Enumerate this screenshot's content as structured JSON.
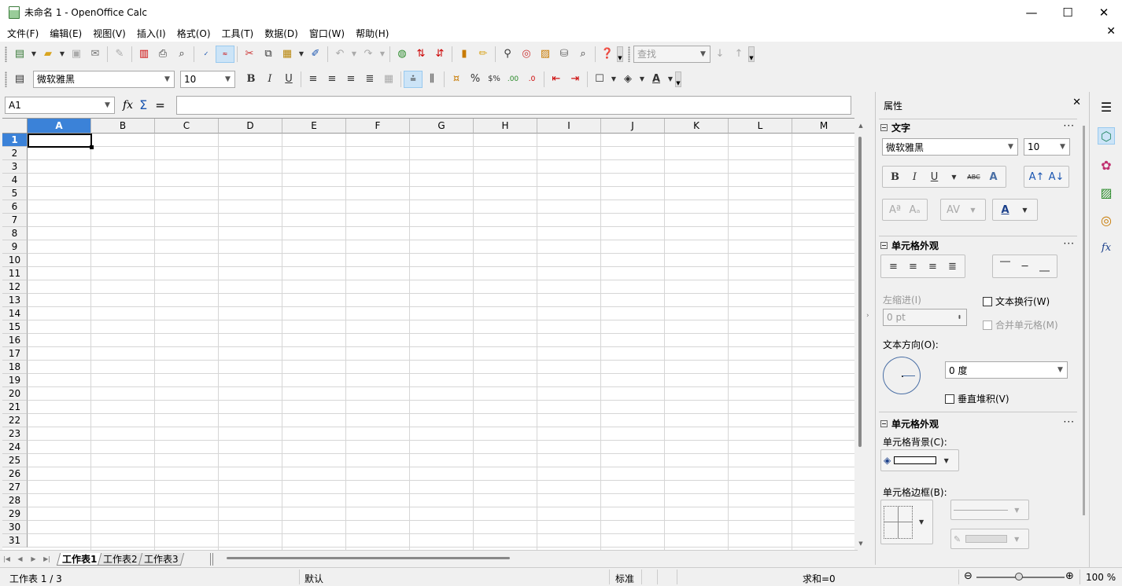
{
  "window": {
    "title": "未命名 1 - OpenOffice Calc",
    "min": "—",
    "max": "☐",
    "close": "✕"
  },
  "menu": [
    "文件(F)",
    "编辑(E)",
    "视图(V)",
    "插入(I)",
    "格式(O)",
    "工具(T)",
    "数据(D)",
    "窗口(W)",
    "帮助(H)"
  ],
  "doc_close": "✕",
  "toolbar1": {
    "find_placeholder": "查找"
  },
  "toolbar2": {
    "font_name": "微软雅黑",
    "font_size": "10"
  },
  "formula": {
    "cell_ref": "A1",
    "fx": "fx",
    "sigma": "Σ",
    "equals": "=",
    "value": ""
  },
  "grid": {
    "columns": [
      "A",
      "B",
      "C",
      "D",
      "E",
      "F",
      "G",
      "H",
      "I",
      "J",
      "K",
      "L",
      "M"
    ],
    "rows": [
      "1",
      "2",
      "3",
      "4",
      "5",
      "6",
      "7",
      "8",
      "9",
      "10",
      "11",
      "12",
      "13",
      "14",
      "15",
      "16",
      "17",
      "18",
      "19",
      "20",
      "21",
      "22",
      "23",
      "24",
      "25",
      "26",
      "27",
      "28",
      "29",
      "30",
      "31"
    ],
    "selected_cell": "A1"
  },
  "sheets": [
    "工作表1",
    "工作表2",
    "工作表3"
  ],
  "active_sheet": "工作表1",
  "status": {
    "sheet": "工作表 1 / 3",
    "style": "默认",
    "mode": "标准",
    "sum": "求和=0",
    "zoom": "100 %"
  },
  "sidebar": {
    "title": "属性",
    "close": "✕",
    "text_section": {
      "title": "文字",
      "font_name": "微软雅黑",
      "font_size": "10",
      "strike_label": "ABC"
    },
    "appearance_section": {
      "title": "单元格外观",
      "indent_label": "左缩进(I)",
      "indent_value": "0 pt",
      "wrap_label": "文本换行(W)",
      "merge_label": "合并单元格(M)",
      "orientation_label": "文本方向(O):",
      "orientation_value": "0 度",
      "stack_label": "垂直堆积(V)"
    },
    "background_section": {
      "title": "单元格外观",
      "background_label": "单元格背景(C):",
      "border_label": "单元格边框(B):"
    },
    "more": "···"
  }
}
